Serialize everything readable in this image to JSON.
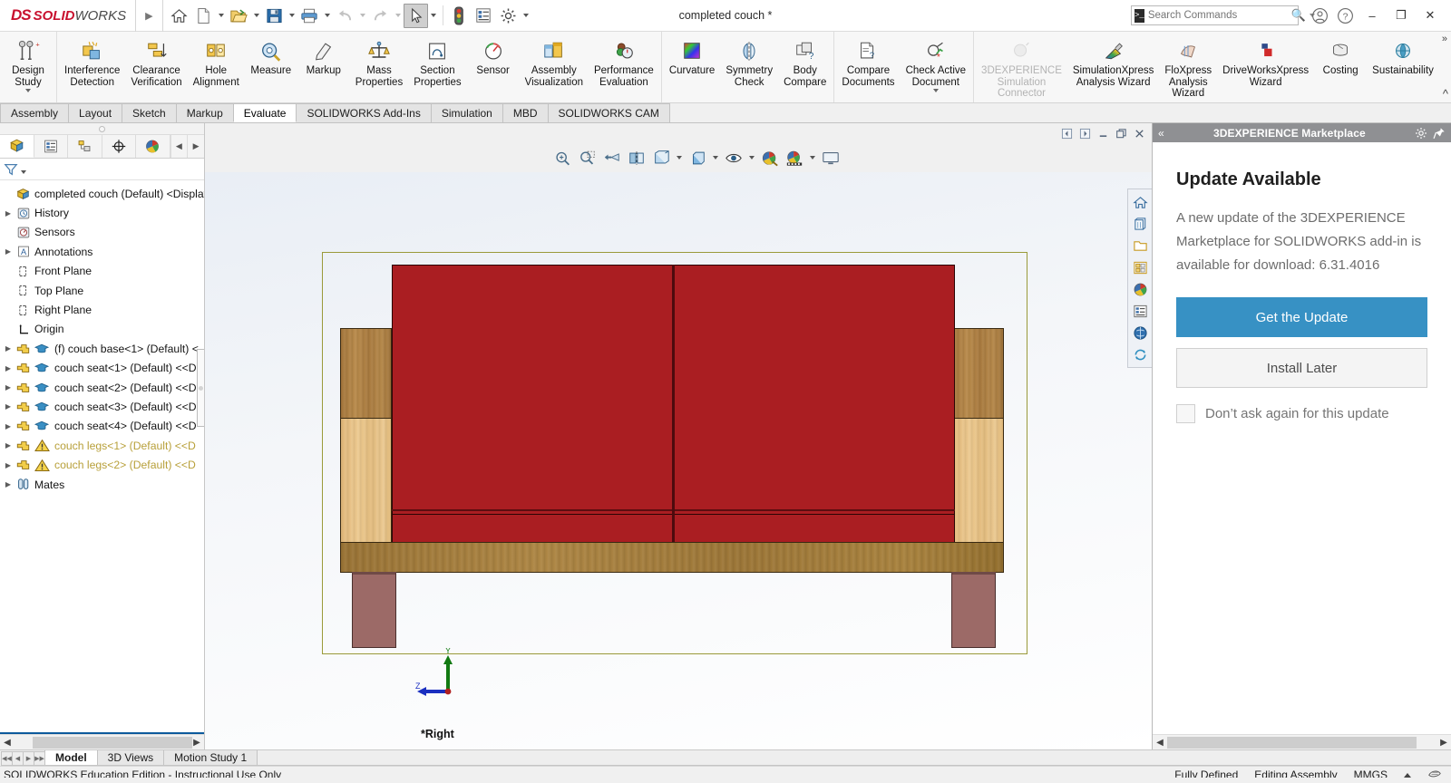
{
  "titlebar": {
    "logo_ds": "DS",
    "logo_solid": "SOLID",
    "logo_works": "WORKS",
    "document_title": "completed couch *",
    "search_placeholder": "Search Commands",
    "quick_access": [
      {
        "name": "home",
        "label": "Home"
      },
      {
        "name": "new-document",
        "label": "New"
      },
      {
        "name": "open-document",
        "label": "Open"
      },
      {
        "name": "save",
        "label": "Save"
      },
      {
        "name": "print",
        "label": "Print"
      },
      {
        "name": "undo",
        "label": "Undo"
      },
      {
        "name": "redo",
        "label": "Redo"
      },
      {
        "name": "select",
        "label": "Select"
      },
      {
        "name": "rebuild",
        "label": "Rebuild"
      },
      {
        "name": "file-properties",
        "label": "File Properties"
      },
      {
        "name": "options",
        "label": "Options"
      }
    ],
    "window_buttons": {
      "minimize": "–",
      "restore": "❐",
      "close": "✕"
    }
  },
  "ribbon": {
    "groups": [
      {
        "items": [
          {
            "label": "Design\nStudy",
            "icon": "design-study-icon",
            "disabled": false,
            "more": true
          }
        ]
      },
      {
        "items": [
          {
            "label": "Interference\nDetection",
            "icon": "interference-detection-icon",
            "disabled": false,
            "more": false
          },
          {
            "label": "Clearance\nVerification",
            "icon": "clearance-verification-icon",
            "disabled": false,
            "more": false
          },
          {
            "label": "Hole\nAlignment",
            "icon": "hole-alignment-icon",
            "disabled": false,
            "more": false
          },
          {
            "label": "Measure",
            "icon": "measure-icon",
            "disabled": false,
            "more": false
          },
          {
            "label": "Markup",
            "icon": "markup-icon",
            "disabled": false,
            "more": false
          },
          {
            "label": "Mass\nProperties",
            "icon": "mass-properties-icon",
            "disabled": false,
            "more": false
          },
          {
            "label": "Section\nProperties",
            "icon": "section-properties-icon",
            "disabled": false,
            "more": false
          },
          {
            "label": "Sensor",
            "icon": "sensor-icon",
            "disabled": false,
            "more": false
          },
          {
            "label": "Assembly\nVisualization",
            "icon": "assembly-visualization-icon",
            "disabled": false,
            "more": false
          },
          {
            "label": "Performance\nEvaluation",
            "icon": "performance-evaluation-icon",
            "disabled": false,
            "more": false
          }
        ]
      },
      {
        "items": [
          {
            "label": "Curvature",
            "icon": "curvature-icon",
            "disabled": false,
            "more": false
          },
          {
            "label": "Symmetry\nCheck",
            "icon": "symmetry-check-icon",
            "disabled": false,
            "more": false
          },
          {
            "label": "Body\nCompare",
            "icon": "body-compare-icon",
            "disabled": false,
            "more": false
          }
        ]
      },
      {
        "items": [
          {
            "label": "Compare\nDocuments",
            "icon": "compare-documents-icon",
            "disabled": false,
            "more": false
          },
          {
            "label": "Check Active\nDocument",
            "icon": "check-active-document-icon",
            "disabled": false,
            "more": true
          }
        ]
      },
      {
        "items": [
          {
            "label": "3DEXPERIENCE\nSimulation\nConnector",
            "icon": "3dexperience-simulation-connector-icon",
            "disabled": true,
            "more": false
          },
          {
            "label": "SimulationXpress\nAnalysis Wizard",
            "icon": "simulationxpress-icon",
            "disabled": false,
            "more": false
          },
          {
            "label": "FloXpress\nAnalysis\nWizard",
            "icon": "floxpress-icon",
            "disabled": false,
            "more": false
          },
          {
            "label": "DriveWorksXpress\nWizard",
            "icon": "driveworksxpress-icon",
            "disabled": false,
            "more": false
          },
          {
            "label": "Costing",
            "icon": "costing-icon",
            "disabled": false,
            "more": false
          },
          {
            "label": "Sustainability",
            "icon": "sustainability-icon",
            "disabled": false,
            "more": false
          }
        ]
      }
    ]
  },
  "command_tabs": {
    "tabs": [
      {
        "label": "Assembly",
        "selected": false
      },
      {
        "label": "Layout",
        "selected": false
      },
      {
        "label": "Sketch",
        "selected": false
      },
      {
        "label": "Markup",
        "selected": false
      },
      {
        "label": "Evaluate",
        "selected": true
      },
      {
        "label": "SOLIDWORKS Add-Ins",
        "selected": false
      },
      {
        "label": "Simulation",
        "selected": false
      },
      {
        "label": "MBD",
        "selected": false
      },
      {
        "label": "SOLIDWORKS CAM",
        "selected": false
      }
    ]
  },
  "feature_manager": {
    "tabs": [
      {
        "name": "feature-manager-tree-tab",
        "selected": true
      },
      {
        "name": "property-manager-tab",
        "selected": false
      },
      {
        "name": "configuration-manager-tab",
        "selected": false
      },
      {
        "name": "dimxpert-manager-tab",
        "selected": false
      },
      {
        "name": "display-manager-tab",
        "selected": false
      }
    ],
    "filter_placeholder": "",
    "tree": [
      {
        "label": "completed couch (Default) <Display S",
        "icon": "assembly-icon",
        "expandable": false,
        "indent": 0,
        "warn": false,
        "root": true
      },
      {
        "label": "History",
        "icon": "history-icon",
        "expandable": true,
        "indent": 1,
        "warn": false
      },
      {
        "label": "Sensors",
        "icon": "sensors-icon",
        "expandable": false,
        "indent": 1,
        "warn": false
      },
      {
        "label": "Annotations",
        "icon": "annotations-icon",
        "expandable": true,
        "indent": 1,
        "warn": false
      },
      {
        "label": "Front Plane",
        "icon": "plane-icon",
        "expandable": false,
        "indent": 1,
        "warn": false
      },
      {
        "label": "Top Plane",
        "icon": "plane-icon",
        "expandable": false,
        "indent": 1,
        "warn": false
      },
      {
        "label": "Right Plane",
        "icon": "plane-icon",
        "expandable": false,
        "indent": 1,
        "warn": false
      },
      {
        "label": "Origin",
        "icon": "origin-icon",
        "expandable": false,
        "indent": 1,
        "warn": false
      },
      {
        "label": "(f) couch base<1>  (Default) <",
        "icon": "part-icon",
        "icon2": "education-icon",
        "expandable": true,
        "indent": 1,
        "warn": false
      },
      {
        "label": "couch seat<1>  (Default) <<D",
        "icon": "part-icon",
        "icon2": "education-icon",
        "expandable": true,
        "indent": 1,
        "warn": false
      },
      {
        "label": "couch seat<2>  (Default) <<D",
        "icon": "part-icon",
        "icon2": "education-icon",
        "expandable": true,
        "indent": 1,
        "warn": false
      },
      {
        "label": "couch seat<3>  (Default) <<D",
        "icon": "part-icon",
        "icon2": "education-icon",
        "expandable": true,
        "indent": 1,
        "warn": false
      },
      {
        "label": "couch seat<4>  (Default) <<D",
        "icon": "part-icon",
        "icon2": "education-icon",
        "expandable": true,
        "indent": 1,
        "warn": false
      },
      {
        "label": "couch legs<1>  (Default) <<D",
        "icon": "part-icon",
        "icon2": "warning-icon",
        "expandable": true,
        "indent": 1,
        "warn": true
      },
      {
        "label": "couch legs<2>  (Default) <<D",
        "icon": "part-icon",
        "icon2": "warning-icon",
        "expandable": true,
        "indent": 1,
        "warn": true
      },
      {
        "label": "Mates",
        "icon": "mates-icon",
        "expandable": true,
        "indent": 1,
        "warn": false
      }
    ]
  },
  "viewport": {
    "view_label": "*Right",
    "triad": {
      "y_axis": "Y",
      "z_axis": "Z"
    },
    "heads_up_toolbar": [
      {
        "name": "zoom-to-fit-icon"
      },
      {
        "name": "zoom-to-area-icon"
      },
      {
        "name": "previous-view-icon"
      },
      {
        "name": "section-view-icon"
      },
      {
        "name": "view-orientation-icon"
      },
      {
        "name": "display-style-icon"
      },
      {
        "name": "hide-show-items-icon"
      },
      {
        "name": "edit-appearance-icon"
      },
      {
        "name": "apply-scene-icon"
      },
      {
        "name": "view-settings-icon"
      }
    ],
    "window_controls": [
      {
        "name": "previous-window-icon"
      },
      {
        "name": "next-window-icon"
      },
      {
        "name": "minimize-window-icon"
      },
      {
        "name": "restore-window-icon"
      },
      {
        "name": "close-window-icon"
      }
    ],
    "side_toolbar": [
      {
        "name": "home-tab-icon"
      },
      {
        "name": "model-views-icon"
      },
      {
        "name": "open-folder-icon"
      },
      {
        "name": "design-library-icon"
      },
      {
        "name": "appearances-scenes-icon"
      },
      {
        "name": "custom-properties-icon"
      },
      {
        "name": "3dexperience-marketplace-icon"
      },
      {
        "name": "sync-icon"
      }
    ],
    "model_colors": {
      "cushion": "#aa1e22",
      "frame_wood_medium": "#b08044",
      "frame_wood_light": "#e6c184",
      "base_wood_dark": "#a37b3c",
      "leg": "#9c6a67",
      "selection_outline": "#9a9a3a"
    }
  },
  "task_pane": {
    "title": "3DEXPERIENCE Marketplace",
    "collapse_glyph": "«",
    "heading": "Update Available",
    "body_text": "A new update of the 3DEXPERIENCE Marketplace for SOLIDWORKS add-in is available for download: 6.31.4016",
    "primary_button": "Get the Update",
    "secondary_button": "Install Later",
    "checkbox_label": "Don’t ask again for this update",
    "checkbox_checked": false,
    "accent_color": "#3791c4"
  },
  "bottom_tabs": {
    "tabs": [
      {
        "label": "Model",
        "selected": true
      },
      {
        "label": "3D Views",
        "selected": false
      },
      {
        "label": "Motion Study 1",
        "selected": false
      }
    ]
  },
  "status_bar": {
    "license_text": "SOLIDWORKS Education Edition - Instructional Use Only",
    "state": "Fully Defined",
    "mode": "Editing Assembly",
    "units": "MMGS"
  }
}
